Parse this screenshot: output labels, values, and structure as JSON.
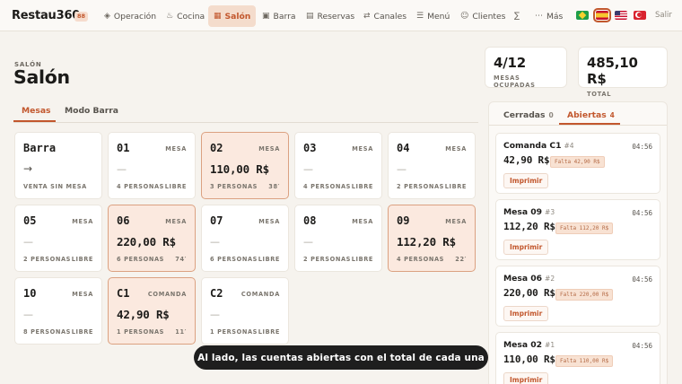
{
  "app": {
    "name": "Restau360",
    "badge": "88"
  },
  "nav": [
    {
      "icon": "◈",
      "label": "Operación"
    },
    {
      "icon": "♨",
      "label": "Cocina"
    },
    {
      "icon": "▦",
      "label": "Salón",
      "active": true
    },
    {
      "icon": "▣",
      "label": "Barra"
    },
    {
      "icon": "▤",
      "label": "Reservas"
    },
    {
      "icon": "⇄",
      "label": "Canales"
    },
    {
      "icon": "☰",
      "label": "Menú"
    },
    {
      "icon": "☺",
      "label": "Clientes"
    },
    {
      "icon": "∑",
      "label": ""
    },
    {
      "icon": "⋯",
      "label": "Más"
    }
  ],
  "languages": [
    "pt-BR",
    "es",
    "en-US",
    "tr"
  ],
  "logout_label": "Salir",
  "header": {
    "breadcrumb": "SALÓN",
    "title": "Salón"
  },
  "stats": [
    {
      "value": "4/12",
      "label": "MESAS OCUPADAS"
    },
    {
      "value": "485,10 R$",
      "label": "TOTAL"
    }
  ],
  "tabs": [
    {
      "label": "Mesas",
      "active": true
    },
    {
      "label": "Modo Barra"
    }
  ],
  "tables": [
    {
      "name": "Barra",
      "type": "",
      "amount": "",
      "footer_left": "VENTA SIN MESA",
      "footer_right": "",
      "occupied": false
    },
    {
      "name": "01",
      "type": "MESA",
      "amount": "",
      "footer_left": "4 PERSONAS",
      "footer_right": "LIBRE",
      "occupied": false
    },
    {
      "name": "02",
      "type": "MESA",
      "amount": "110,00 R$",
      "footer_left": "3 PERSONAS",
      "footer_right": "38′",
      "occupied": true
    },
    {
      "name": "03",
      "type": "MESA",
      "amount": "",
      "footer_left": "4 PERSONAS",
      "footer_right": "LIBRE",
      "occupied": false
    },
    {
      "name": "04",
      "type": "MESA",
      "amount": "",
      "footer_left": "2 PERSONAS",
      "footer_right": "LIBRE",
      "occupied": false
    },
    {
      "name": "05",
      "type": "MESA",
      "amount": "",
      "footer_left": "2 PERSONAS",
      "footer_right": "LIBRE",
      "occupied": false
    },
    {
      "name": "06",
      "type": "MESA",
      "amount": "220,00 R$",
      "footer_left": "6 PERSONAS",
      "footer_right": "74′",
      "occupied": true
    },
    {
      "name": "07",
      "type": "MESA",
      "amount": "",
      "footer_left": "6 PERSONAS",
      "footer_right": "LIBRE",
      "occupied": false
    },
    {
      "name": "08",
      "type": "MESA",
      "amount": "",
      "footer_left": "2 PERSONAS",
      "footer_right": "LIBRE",
      "occupied": false
    },
    {
      "name": "09",
      "type": "MESA",
      "amount": "112,20 R$",
      "footer_left": "4 PERSONAS",
      "footer_right": "22′",
      "occupied": true
    },
    {
      "name": "10",
      "type": "MESA",
      "amount": "",
      "footer_left": "8 PERSONAS",
      "footer_right": "LIBRE",
      "occupied": false
    },
    {
      "name": "C1",
      "type": "COMANDA",
      "amount": "42,90 R$",
      "footer_left": "1 PERSONAS",
      "footer_right": "11′",
      "occupied": true
    },
    {
      "name": "C2",
      "type": "COMANDA",
      "amount": "",
      "footer_left": "1 PERSONAS",
      "footer_right": "LIBRE",
      "occupied": false
    }
  ],
  "panel": {
    "tabs": [
      {
        "label": "Cerradas",
        "count": "0"
      },
      {
        "label": "Abiertas",
        "count": "4",
        "active": true
      }
    ],
    "accounts": [
      {
        "name": "Comanda C1",
        "number": "#4",
        "time": "04:56",
        "total": "42,90 R$",
        "remaining": "Falta 42,90 R$",
        "print_label": "Imprimir"
      },
      {
        "name": "Mesa 09",
        "number": "#3",
        "time": "04:56",
        "total": "112,20 R$",
        "remaining": "Falta 112,20 R$",
        "print_label": "Imprimir"
      },
      {
        "name": "Mesa 06",
        "number": "#2",
        "time": "04:56",
        "total": "220,00 R$",
        "remaining": "Falta 220,00 R$",
        "print_label": "Imprimir"
      },
      {
        "name": "Mesa 02",
        "number": "#1",
        "time": "04:56",
        "total": "110,00 R$",
        "remaining": "Falta 110,00 R$",
        "print_label": "Imprimir"
      }
    ]
  },
  "toast": "Al lado, las cuentas abiertas con el total de cada una",
  "colors": {
    "accent": "#c2572d",
    "occupied_bg": "#fbe9df",
    "background": "#f6f3ee"
  }
}
